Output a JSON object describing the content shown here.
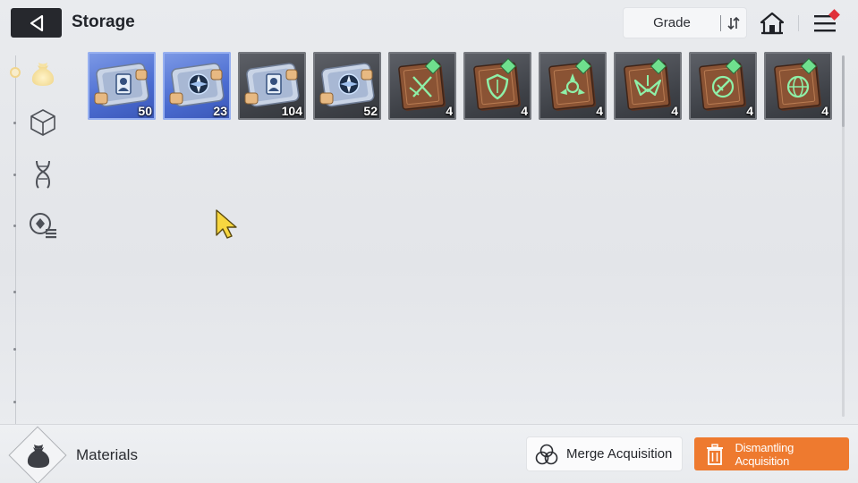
{
  "header": {
    "title": "Storage",
    "sort_label": "Grade",
    "menu_has_notification": true
  },
  "categories": [
    {
      "icon": "pouch-icon",
      "active": true
    },
    {
      "icon": "cube-icon",
      "active": false
    },
    {
      "icon": "dna-icon",
      "active": false
    },
    {
      "icon": "gear-list-icon",
      "active": false
    }
  ],
  "items": [
    {
      "kind": "ticket-card",
      "grade": "blue",
      "qty": "50"
    },
    {
      "kind": "ticket-compass",
      "grade": "blue",
      "qty": "23"
    },
    {
      "kind": "ticket-card",
      "grade": "gray",
      "qty": "104"
    },
    {
      "kind": "ticket-compass",
      "grade": "gray",
      "qty": "52"
    },
    {
      "kind": "book-swords",
      "grade": "gray",
      "qty": "4"
    },
    {
      "kind": "book-shield",
      "grade": "gray",
      "qty": "4"
    },
    {
      "kind": "book-target",
      "grade": "gray",
      "qty": "4"
    },
    {
      "kind": "book-wings",
      "grade": "gray",
      "qty": "4"
    },
    {
      "kind": "book-slash",
      "grade": "gray",
      "qty": "4"
    },
    {
      "kind": "book-globe",
      "grade": "gray",
      "qty": "4"
    }
  ],
  "footer": {
    "category_name": "Materials",
    "merge_label": "Merge Acquisition",
    "dismantle_label": "Dismantling Acquisition"
  },
  "colors": {
    "accent_orange": "#ee7a2f",
    "grade_blue": "#4a6bd0",
    "grade_gray": "#3d4046",
    "rune_green": "#8ef0a8",
    "notification_red": "#e0303a"
  }
}
